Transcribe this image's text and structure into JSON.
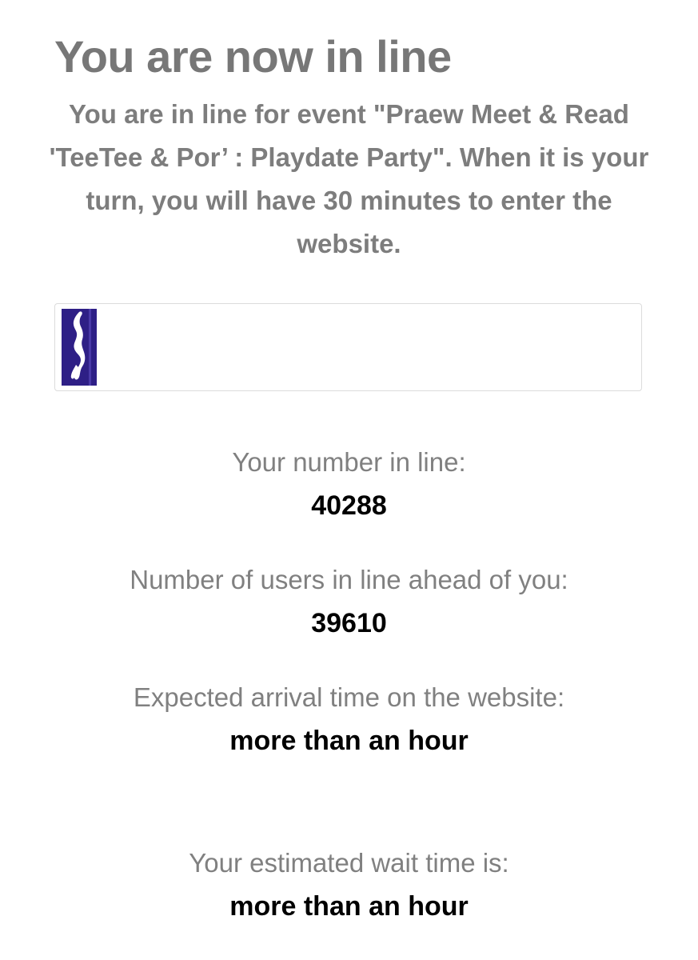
{
  "header": {
    "title": "You are now in line"
  },
  "intro": {
    "text": "You are in line for event \"Praew Meet & Read 'TeeTee & Por’ : Playdate Party\". When it is your turn, you will have 30 minutes to enter the website."
  },
  "progress": {
    "fraction": 0.061,
    "icon": "runner-icon",
    "fill_color": "#2e1f86"
  },
  "stats": {
    "number_in_line": {
      "label": "Your number in line:",
      "value": "40288"
    },
    "users_ahead": {
      "label": "Number of users in line ahead of you:",
      "value": "39610"
    },
    "expected_arrival": {
      "label": "Expected arrival time on the website:",
      "value": "more than an hour"
    },
    "estimated_wait": {
      "label": "Your estimated wait time is:",
      "value": "more than an hour"
    }
  }
}
